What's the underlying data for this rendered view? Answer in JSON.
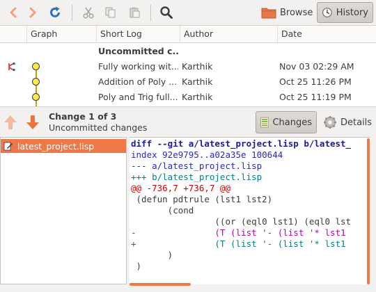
{
  "toolbar": {
    "browse_label": "Browse",
    "history_label": "History"
  },
  "log": {
    "columns": [
      "Graph",
      "Short Log",
      "Author",
      "Date"
    ],
    "rows": [
      {
        "short_log": "Uncommitted c...",
        "author": "",
        "date": ""
      },
      {
        "short_log": "Fully working wit...",
        "author": "Karthik",
        "date": "Nov 03 02:29 AM"
      },
      {
        "short_log": "Addition of Poly ...",
        "author": "Karthik",
        "date": "Oct 25 11:26 PM"
      },
      {
        "short_log": "Poly and Trig full...",
        "author": "Karthik",
        "date": "Oct 25 11:19 PM"
      }
    ]
  },
  "change": {
    "title": "Change 1 of 3",
    "subtitle": "Uncommitted changes",
    "changes_label": "Changes",
    "details_label": "Details"
  },
  "files": {
    "items": [
      "latest_project.lisp"
    ]
  },
  "diff": {
    "lines": [
      {
        "kind": "header",
        "text": "diff --git a/latest_project.lisp b/latest_"
      },
      {
        "kind": "index",
        "text": "index 92e9795..a02a35e 100644"
      },
      {
        "kind": "file",
        "text": "--- a/latest_project.lisp"
      },
      {
        "kind": "file-add",
        "text": "+++ b/latest_project.lisp"
      },
      {
        "kind": "hunk",
        "text": "@@ -736,7 +736,7 @@"
      },
      {
        "kind": "ctx",
        "text": " (defun pdtrule (lst1 lst2)"
      },
      {
        "kind": "ctx",
        "text": "       (cond"
      },
      {
        "kind": "ctx",
        "text": "                ((or (eql0 lst1) (eql0 lst"
      },
      {
        "kind": "del",
        "text": "-               (T (list '- (list '* lst1"
      },
      {
        "kind": "add",
        "text": "+               (T (list '- (list '* lst1"
      },
      {
        "kind": "ctx",
        "text": "       )"
      },
      {
        "kind": "ctx",
        "text": " )"
      }
    ]
  },
  "colors": {
    "accent": "#f07746",
    "graph_node": "#fce94f"
  }
}
